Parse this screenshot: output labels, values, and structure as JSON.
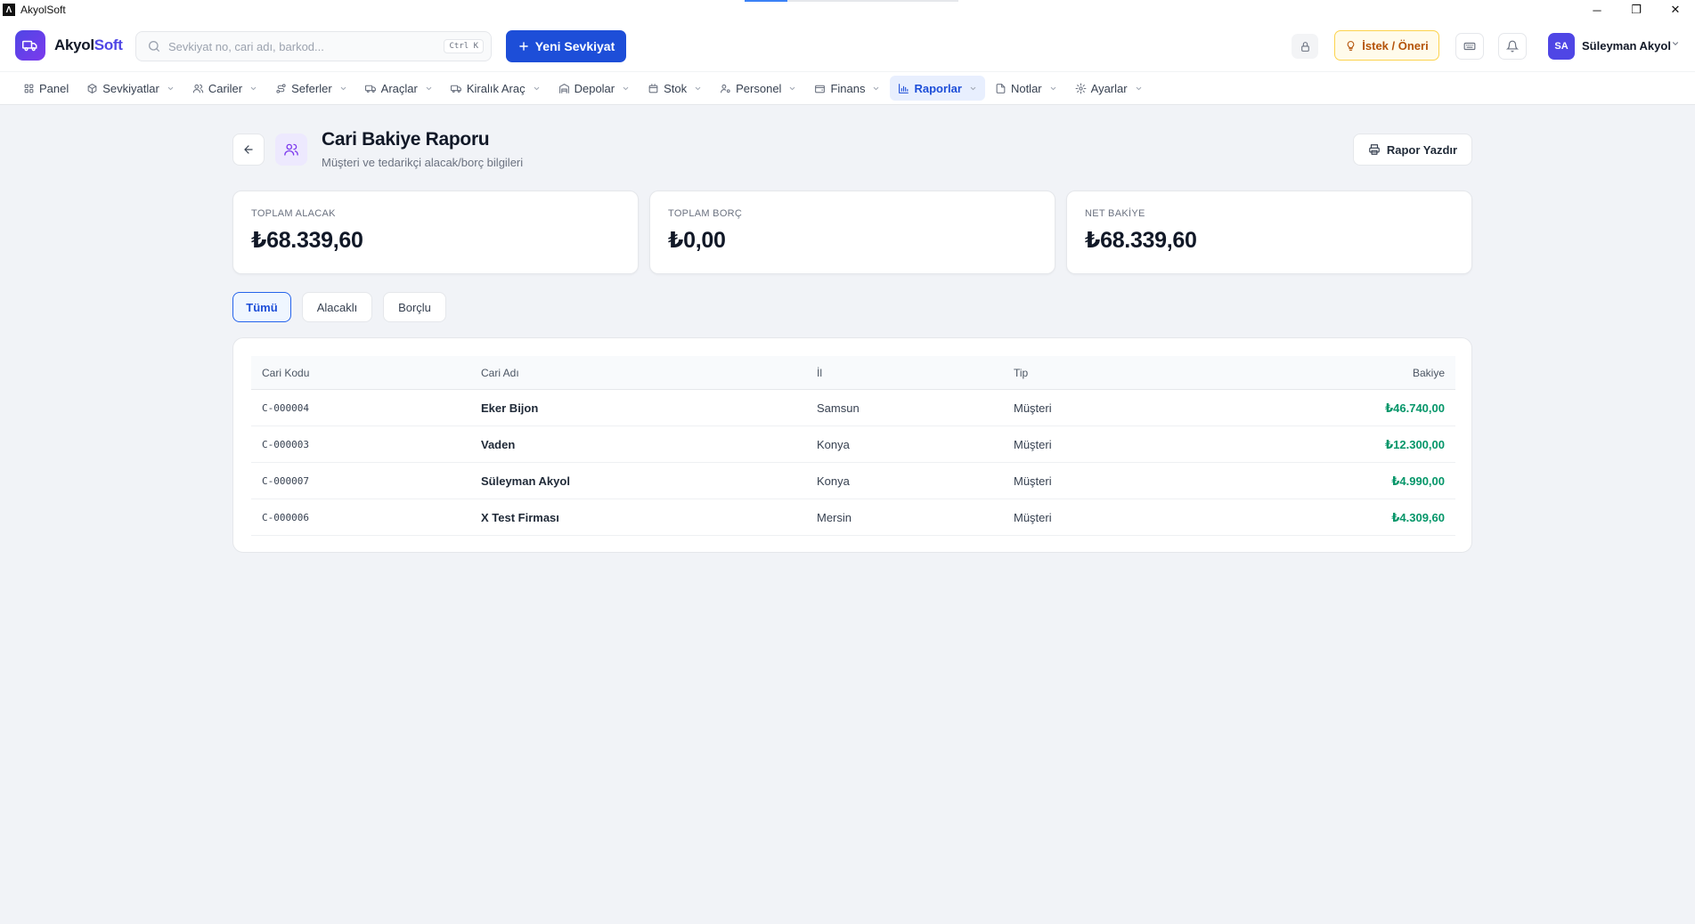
{
  "window": {
    "title": "AkyolSoft",
    "controls": [
      "─",
      "❐",
      "✕"
    ]
  },
  "header": {
    "brand_main": "Akyol",
    "brand_accent": "Soft",
    "search_placeholder": "Sevkiyat no, cari adı, barkod...",
    "search_shortcut": "Ctrl K",
    "new_shipment_label": "Yeni Sevkiyat",
    "suggest_label": "İstek / Öneri",
    "user_initials": "SA",
    "user_name": "Süleyman Akyol"
  },
  "nav": {
    "items": [
      {
        "label": "Panel",
        "icon": "grid-icon",
        "has_menu": false
      },
      {
        "label": "Sevkiyatlar",
        "icon": "box-icon",
        "has_menu": true
      },
      {
        "label": "Cariler",
        "icon": "users-icon",
        "has_menu": true
      },
      {
        "label": "Seferler",
        "icon": "route-icon",
        "has_menu": true
      },
      {
        "label": "Araçlar",
        "icon": "truck-icon",
        "has_menu": true
      },
      {
        "label": "Kiralık Araç",
        "icon": "truck-icon",
        "has_menu": true
      },
      {
        "label": "Depolar",
        "icon": "warehouse-icon",
        "has_menu": true
      },
      {
        "label": "Stok",
        "icon": "package-icon",
        "has_menu": true
      },
      {
        "label": "Personel",
        "icon": "user-cog-icon",
        "has_menu": true
      },
      {
        "label": "Finans",
        "icon": "wallet-icon",
        "has_menu": true
      },
      {
        "label": "Raporlar",
        "icon": "bar-chart-icon",
        "has_menu": true,
        "active": true
      },
      {
        "label": "Notlar",
        "icon": "file-icon",
        "has_menu": true
      },
      {
        "label": "Ayarlar",
        "icon": "gear-icon",
        "has_menu": true
      }
    ]
  },
  "page": {
    "title": "Cari Bakiye Raporu",
    "subtitle": "Müşteri ve tedarikçi alacak/borç bilgileri",
    "print_label": "Rapor Yazdır"
  },
  "stats": [
    {
      "label": "TOPLAM ALACAK",
      "value": "₺68.339,60"
    },
    {
      "label": "TOPLAM BORÇ",
      "value": "₺0,00"
    },
    {
      "label": "NET BAKİYE",
      "value": "₺68.339,60"
    }
  ],
  "filters": [
    {
      "label": "Tümü",
      "active": true
    },
    {
      "label": "Alacaklı",
      "active": false
    },
    {
      "label": "Borçlu",
      "active": false
    }
  ],
  "table": {
    "headers": [
      "Cari Kodu",
      "Cari Adı",
      "İl",
      "Tip",
      "Bakiye"
    ],
    "rows": [
      {
        "code": "C-000004",
        "name": "Eker Bijon",
        "city": "Samsun",
        "type": "Müşteri",
        "balance": "₺46.740,00"
      },
      {
        "code": "C-000003",
        "name": "Vaden",
        "city": "Konya",
        "type": "Müşteri",
        "balance": "₺12.300,00"
      },
      {
        "code": "C-000007",
        "name": "Süleyman Akyol",
        "city": "Konya",
        "type": "Müşteri",
        "balance": "₺4.990,00"
      },
      {
        "code": "C-000006",
        "name": "X Test Firması",
        "city": "Mersin",
        "type": "Müşteri",
        "balance": "₺4.309,60"
      }
    ]
  },
  "colors": {
    "primary": "#1d4ed8",
    "brand": "#4f46e5",
    "positive_balance": "#059669",
    "suggest": "#b45309"
  }
}
